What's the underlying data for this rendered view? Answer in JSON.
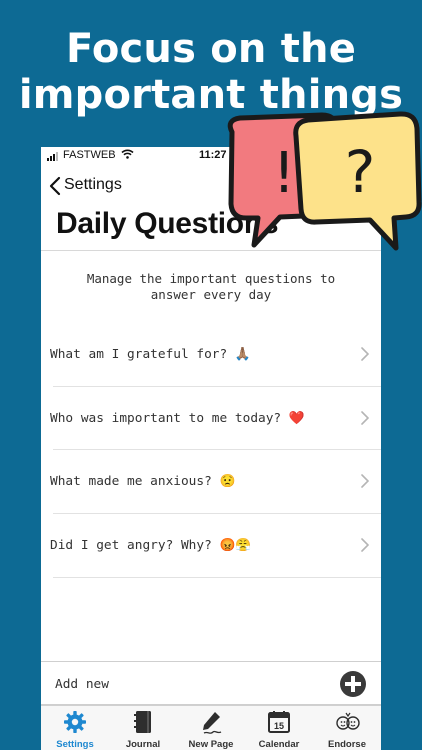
{
  "headline": {
    "line1": "Focus on the",
    "line2": "important things"
  },
  "status": {
    "carrier": "FASTWEB",
    "time": "11:27"
  },
  "nav": {
    "back_label": "Settings"
  },
  "page": {
    "title": "Daily Questions",
    "subtitle_line1": "Manage the important questions to",
    "subtitle_line2": "answer every day"
  },
  "questions": [
    {
      "text": "What am I grateful for? 🙏🏽"
    },
    {
      "text": "Who was important to me today? ❤️"
    },
    {
      "text": "What made me anxious? 😟"
    },
    {
      "text": "Did I get angry? Why? 😡😤"
    }
  ],
  "add": {
    "label": "Add new"
  },
  "tabs": [
    {
      "label": "Settings",
      "icon": "gear-icon",
      "active": true
    },
    {
      "label": "Journal",
      "icon": "journal-icon",
      "active": false
    },
    {
      "label": "New Page",
      "icon": "pen-icon",
      "active": false
    },
    {
      "label": "Calendar",
      "icon": "calendar-icon",
      "active": false,
      "badge": "15"
    },
    {
      "label": "Endorse",
      "icon": "endorse-icon",
      "active": false
    }
  ],
  "colors": {
    "background": "#0d6a94",
    "accent": "#1e88d0",
    "bubble_red": "#f27a7f",
    "bubble_yellow": "#fde28a"
  },
  "bubble_marks": {
    "exclamation": "!",
    "question": "?"
  }
}
